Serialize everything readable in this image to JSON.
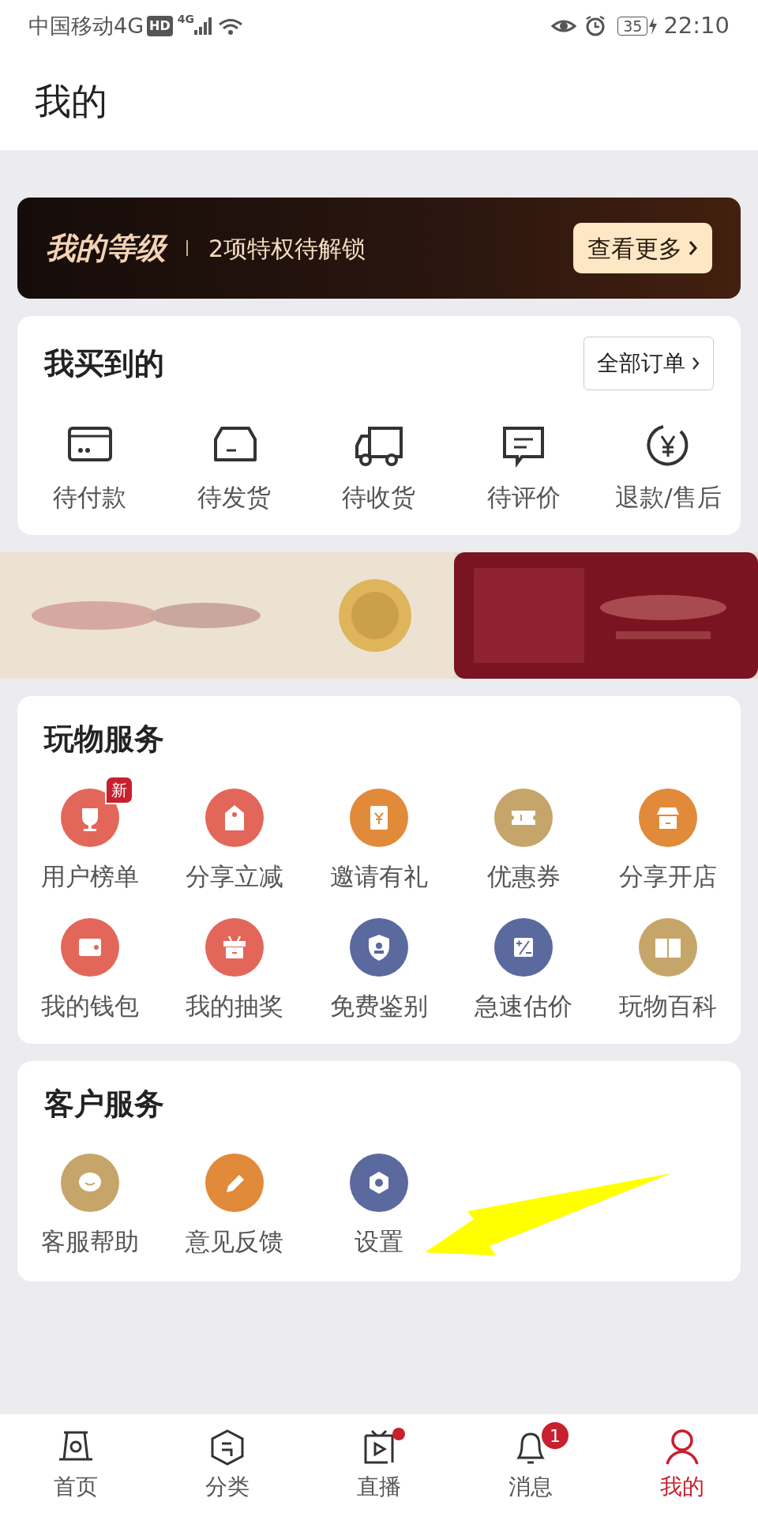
{
  "status_bar": {
    "carrier": "中国移动4G",
    "hd": "HD",
    "network": "4G",
    "battery": "35",
    "time": "22:10"
  },
  "header": {
    "title": "我的"
  },
  "level_banner": {
    "title": "我的等级",
    "subtitle": "2项特权待解锁",
    "button": "查看更多"
  },
  "orders": {
    "title": "我买到的",
    "button": "全部订单",
    "items": [
      {
        "label": "待付款",
        "kind": "card"
      },
      {
        "label": "待发货",
        "kind": "box"
      },
      {
        "label": "待收货",
        "kind": "truck"
      },
      {
        "label": "待评价",
        "kind": "comment"
      },
      {
        "label": "退款/售后",
        "kind": "refund"
      }
    ]
  },
  "services": {
    "title": "玩物服务",
    "items": [
      {
        "label": "用户榜单",
        "kind": "trophy",
        "color": "#e2675a",
        "badge": "新"
      },
      {
        "label": "分享立减",
        "kind": "tag",
        "color": "#e2675a"
      },
      {
        "label": "邀请有礼",
        "kind": "envelope",
        "color": "#e08a3a"
      },
      {
        "label": "优惠券",
        "kind": "ticket",
        "color": "#c6a56a"
      },
      {
        "label": "分享开店",
        "kind": "shop",
        "color": "#e08a3a"
      },
      {
        "label": "我的钱包",
        "kind": "wallet",
        "color": "#e2675a"
      },
      {
        "label": "我的抽奖",
        "kind": "basket",
        "color": "#e2675a"
      },
      {
        "label": "免费鉴别",
        "kind": "shield",
        "color": "#5a6a9e"
      },
      {
        "label": "急速估价",
        "kind": "calc",
        "color": "#5a6a9e"
      },
      {
        "label": "玩物百科",
        "kind": "book",
        "color": "#c6a56a"
      }
    ]
  },
  "customer_service": {
    "title": "客户服务",
    "items": [
      {
        "label": "客服帮助",
        "kind": "chat",
        "color": "#c6a56a"
      },
      {
        "label": "意见反馈",
        "kind": "pencil",
        "color": "#e08a3a"
      },
      {
        "label": "设置",
        "kind": "gear",
        "color": "#5a6a9e"
      }
    ]
  },
  "annotation": {
    "kind": "arrow"
  },
  "tab_bar": [
    {
      "label": "首页",
      "kind": "home",
      "selected": false
    },
    {
      "label": "分类",
      "kind": "hex",
      "selected": false
    },
    {
      "label": "直播",
      "kind": "tv",
      "selected": false,
      "dot": true
    },
    {
      "label": "消息",
      "kind": "bell",
      "selected": false,
      "badge": "1"
    },
    {
      "label": "我的",
      "kind": "person",
      "selected": true
    }
  ]
}
